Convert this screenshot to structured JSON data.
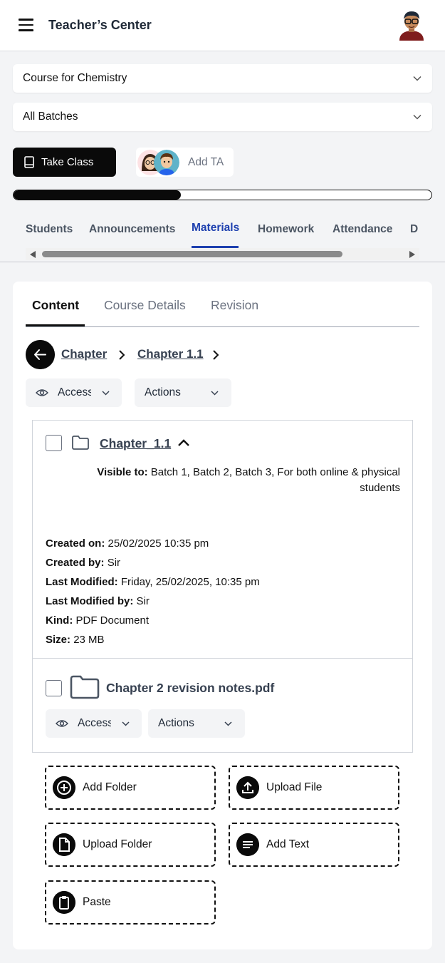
{
  "header": {
    "title": "Teacher’s Center",
    "menu_icon": "hamburger-menu-icon",
    "avatar": "teacher-avatar"
  },
  "course_select": {
    "value": "Course for Chemistry"
  },
  "batch_select": {
    "value": "All Batches"
  },
  "take_class": {
    "label": "Take Class",
    "icon": "book-icon"
  },
  "add_ta": {
    "label": "Add TA"
  },
  "progress": {
    "fraction": 0.4
  },
  "tabs": [
    "Students",
    "Announcements",
    "Materials",
    "Homework",
    "Attendance",
    "D"
  ],
  "active_tab": "Materials",
  "subtabs": [
    "Content",
    "Course Details",
    "Revision"
  ],
  "breadcrumb": [
    "Chapter",
    "Chapter 1.1"
  ],
  "toolbar": {
    "access_label": "Access",
    "actions_label": "Actions"
  },
  "item1": {
    "title": "Chapter_1.1",
    "visible_label": "Visible to:",
    "visible_value": "Batch 1, Batch 2, Batch 3, For both online & physical students",
    "meta": [
      {
        "label": "Created on:",
        "value": "25/02/2025 10:35 pm"
      },
      {
        "label": "Created by:",
        "value": "Sir"
      },
      {
        "label": "Last Modified:",
        "value": "Friday, 25/02/2025, 10:35 pm"
      },
      {
        "label": "Last Modified by:",
        "value": "Sir"
      },
      {
        "label": "Kind:",
        "value": "PDF Document"
      },
      {
        "label": "Size:",
        "value": "23 MB"
      }
    ]
  },
  "item2": {
    "title": "Chapter 2 revision notes.pdf",
    "access_label": "Access",
    "actions_label": "Actions"
  },
  "actions": [
    "Add Folder",
    "Upload File",
    "Upload Folder",
    "Add Text",
    "Paste"
  ],
  "colors": {
    "accent": "#1e40af",
    "primary": "#0a0a0a",
    "page_bg": "#f3f4f6"
  }
}
